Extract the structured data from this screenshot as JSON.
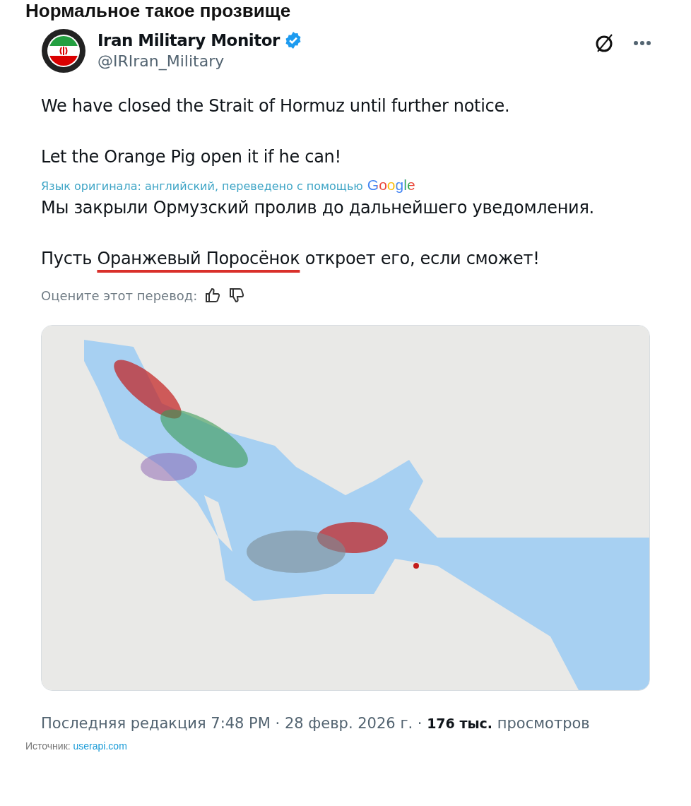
{
  "post_title": "Нормальное такое прозвище",
  "tweet": {
    "author": {
      "name": "Iran Military Monitor",
      "verified": true,
      "handle": "@IRIran_Military"
    },
    "text": [
      "We have closed the Strait of Hormuz until further notice.",
      "Let the Orange Pig open it if he can!"
    ],
    "translation_note": {
      "text": "Язык оригинала: английский, переведено с помощью",
      "provider": "Google"
    },
    "translation": [
      {
        "before": "Мы закрыли Ормузский пролив до дальнейшего уведомления."
      },
      {
        "before": "Пусть ",
        "underlined": "Оранжевый Поросёнок",
        "after": " откроет его, если сможет!"
      }
    ],
    "rate_prompt": "Оцените этот перевод:",
    "meta": {
      "edited": "Последняя редакция 7:48 PM · 28 февр. 2026 г. · ",
      "views": "176 тыс.",
      "views_label": " просмотров"
    }
  },
  "source": {
    "label": "Источник: ",
    "link": "userapi.com"
  }
}
